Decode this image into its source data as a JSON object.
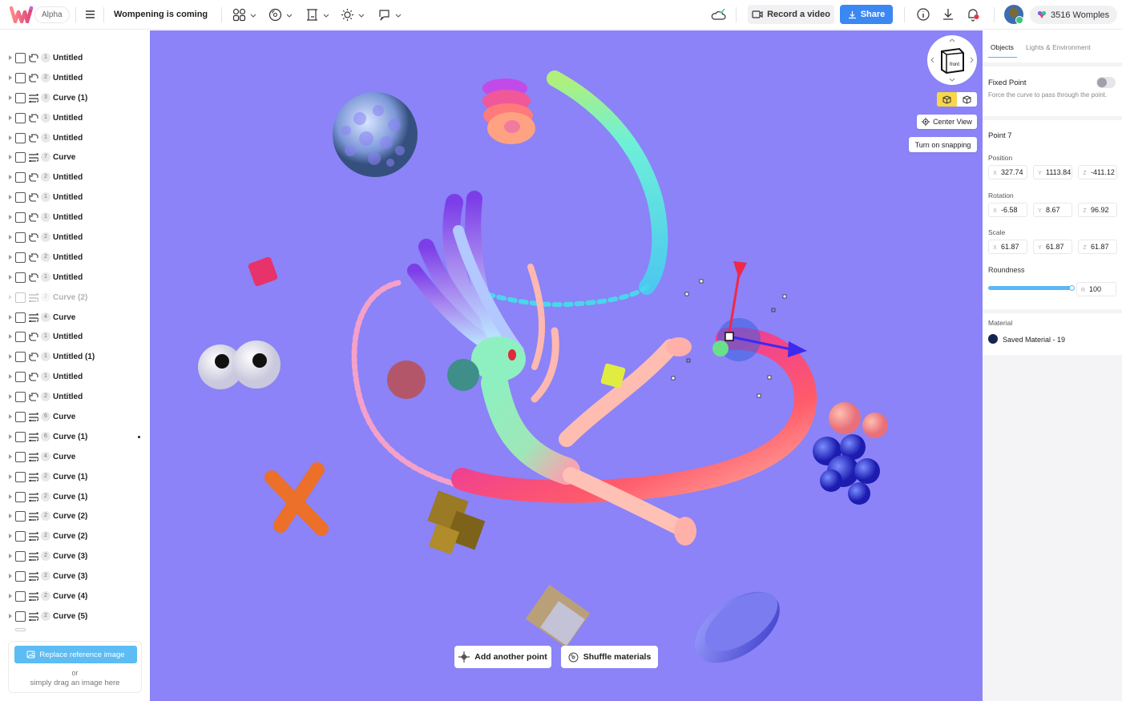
{
  "topbar": {
    "badge": "Alpha",
    "project_title": "Wompening is coming",
    "tools": [
      {
        "icon": "shapes-icon"
      },
      {
        "icon": "material-icon"
      },
      {
        "icon": "frame-icon"
      },
      {
        "icon": "light-icon"
      },
      {
        "icon": "lasso-icon"
      }
    ],
    "record_label": "Record a video",
    "share_label": "Share",
    "womples_label": "3516 Womples",
    "colors": {
      "share": "#3b87f3",
      "viewport": "#8b83f7",
      "accent": "#5cbcf3"
    }
  },
  "layers": [
    {
      "type": "shape",
      "count": "1",
      "name": "Untitled"
    },
    {
      "type": "shape",
      "count": "2",
      "name": "Untitled"
    },
    {
      "type": "curve",
      "count": "3",
      "name": "Curve (1)"
    },
    {
      "type": "shape",
      "count": "1",
      "name": "Untitled"
    },
    {
      "type": "shape",
      "count": "1",
      "name": "Untitled"
    },
    {
      "type": "curve",
      "count": "7",
      "name": "Curve"
    },
    {
      "type": "shape",
      "count": "2",
      "name": "Untitled"
    },
    {
      "type": "shape",
      "count": "1",
      "name": "Untitled"
    },
    {
      "type": "shape",
      "count": "1",
      "name": "Untitled"
    },
    {
      "type": "shape",
      "count": "2",
      "name": "Untitled"
    },
    {
      "type": "shape",
      "count": "2",
      "name": "Untitled"
    },
    {
      "type": "shape",
      "count": "1",
      "name": "Untitled"
    },
    {
      "type": "curve",
      "count": "2",
      "name": "Curve (2)",
      "dimmed": true
    },
    {
      "type": "curve",
      "count": "4",
      "name": "Curve"
    },
    {
      "type": "shape",
      "count": "1",
      "name": "Untitled"
    },
    {
      "type": "shape",
      "count": "1",
      "name": "Untitled (1)"
    },
    {
      "type": "shape",
      "count": "1",
      "name": "Untitled"
    },
    {
      "type": "shape",
      "count": "2",
      "name": "Untitled"
    },
    {
      "type": "curve",
      "count": "6",
      "name": "Curve"
    },
    {
      "type": "curve",
      "count": "6",
      "name": "Curve (1)",
      "marked": true
    },
    {
      "type": "curve",
      "count": "4",
      "name": "Curve"
    },
    {
      "type": "curve",
      "count": "2",
      "name": "Curve (1)"
    },
    {
      "type": "curve",
      "count": "2",
      "name": "Curve (1)"
    },
    {
      "type": "curve",
      "count": "2",
      "name": "Curve (2)"
    },
    {
      "type": "curve",
      "count": "2",
      "name": "Curve (2)"
    },
    {
      "type": "curve",
      "count": "2",
      "name": "Curve (3)"
    },
    {
      "type": "curve",
      "count": "2",
      "name": "Curve (3)"
    },
    {
      "type": "curve",
      "count": "2",
      "name": "Curve (4)"
    },
    {
      "type": "curve",
      "count": "2",
      "name": "Curve (5)"
    }
  ],
  "reference": {
    "button_label": "Replace reference image",
    "or_label": "or",
    "drag_label": "simply drag an image here"
  },
  "viewport": {
    "navcube_face": "front",
    "center_view_label": "Center View",
    "snapping_label": "Turn on snapping",
    "add_point_label": "Add another point",
    "shuffle_label": "Shuffle materials"
  },
  "inspector": {
    "tabs": [
      {
        "label": "Objects",
        "active": true
      },
      {
        "label": "Lights & Environment",
        "active": false
      }
    ],
    "fixed_point": {
      "title": "Fixed Point",
      "description": "Force the curve to pass through the point.",
      "enabled": false
    },
    "point_title": "Point 7",
    "position": {
      "label": "Position",
      "x": "327.74",
      "y": "1113.84",
      "z": "-411.12"
    },
    "rotation": {
      "label": "Rotation",
      "x": "-6.58",
      "y": "8.67",
      "z": "96.92"
    },
    "scale": {
      "label": "Scale",
      "x": "61.87",
      "y": "61.87",
      "z": "61.87"
    },
    "roundness": {
      "label": "Roundness",
      "axis": "R",
      "value": "100",
      "fraction": 1.0
    },
    "material": {
      "label": "Material",
      "name": "Saved Material - 19",
      "swatch": "#13254f"
    }
  }
}
